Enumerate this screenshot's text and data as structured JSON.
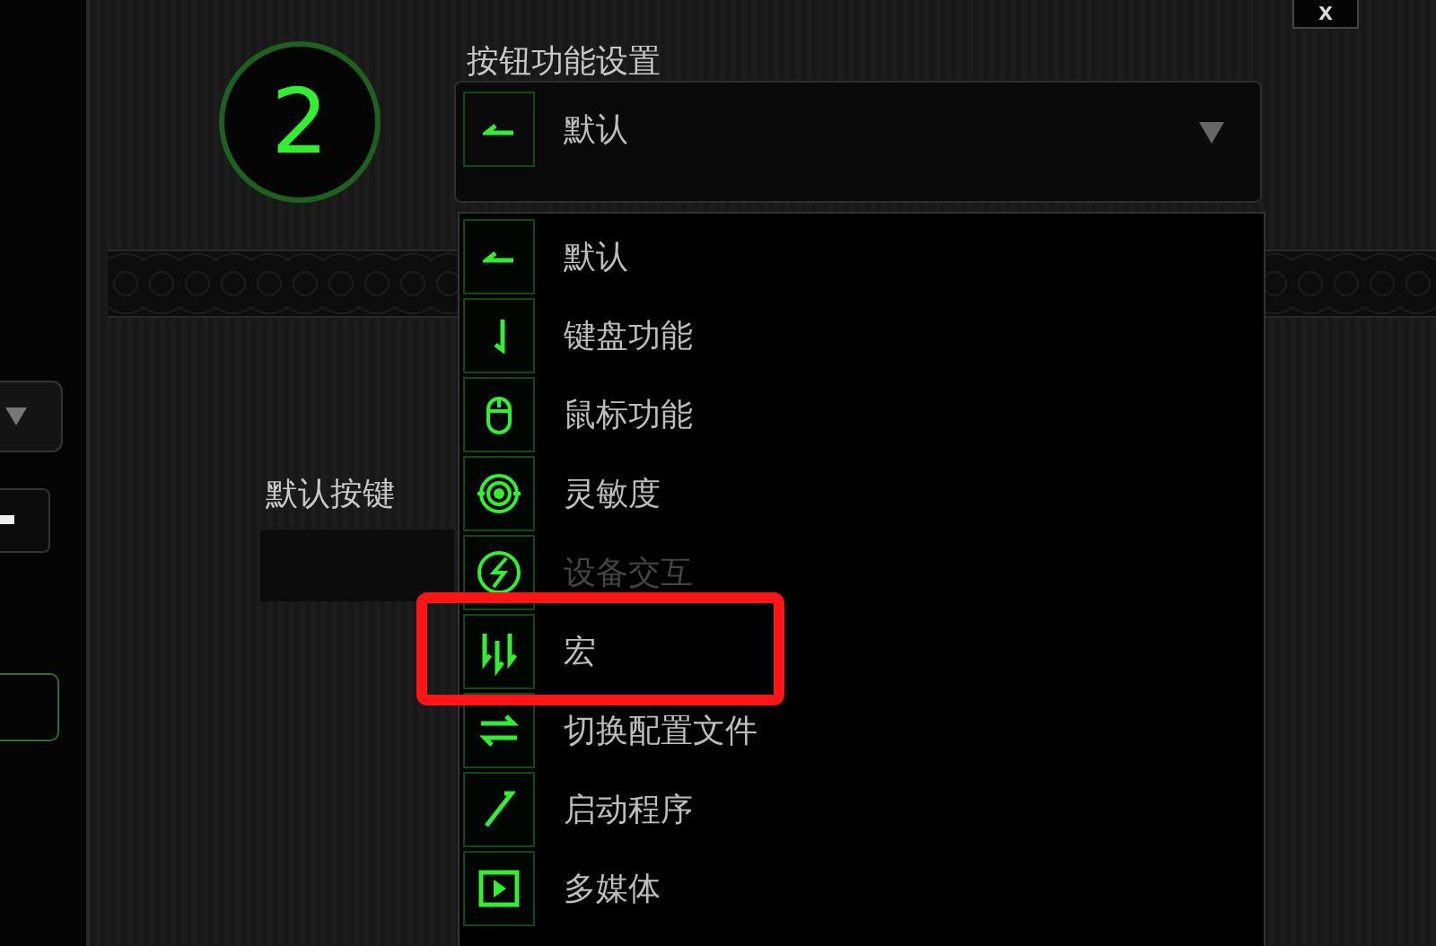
{
  "close_button": "x",
  "button_number": "2",
  "function_setting": {
    "label": "按钮功能设置",
    "value": "默认"
  },
  "default_key": {
    "label": "默认按键"
  },
  "function_menu": {
    "items": [
      {
        "label": "默认",
        "disabled": false,
        "highlighted": false
      },
      {
        "label": "键盘功能",
        "disabled": false,
        "highlighted": false
      },
      {
        "label": "鼠标功能",
        "disabled": false,
        "highlighted": false
      },
      {
        "label": "灵敏度",
        "disabled": false,
        "highlighted": false
      },
      {
        "label": "设备交互",
        "disabled": true,
        "highlighted": false
      },
      {
        "label": "宏",
        "disabled": false,
        "highlighted": true
      },
      {
        "label": "切换配置文件",
        "disabled": false,
        "highlighted": false
      },
      {
        "label": "启动程序",
        "disabled": false,
        "highlighted": false
      },
      {
        "label": "多媒体",
        "disabled": false,
        "highlighted": false
      }
    ]
  }
}
